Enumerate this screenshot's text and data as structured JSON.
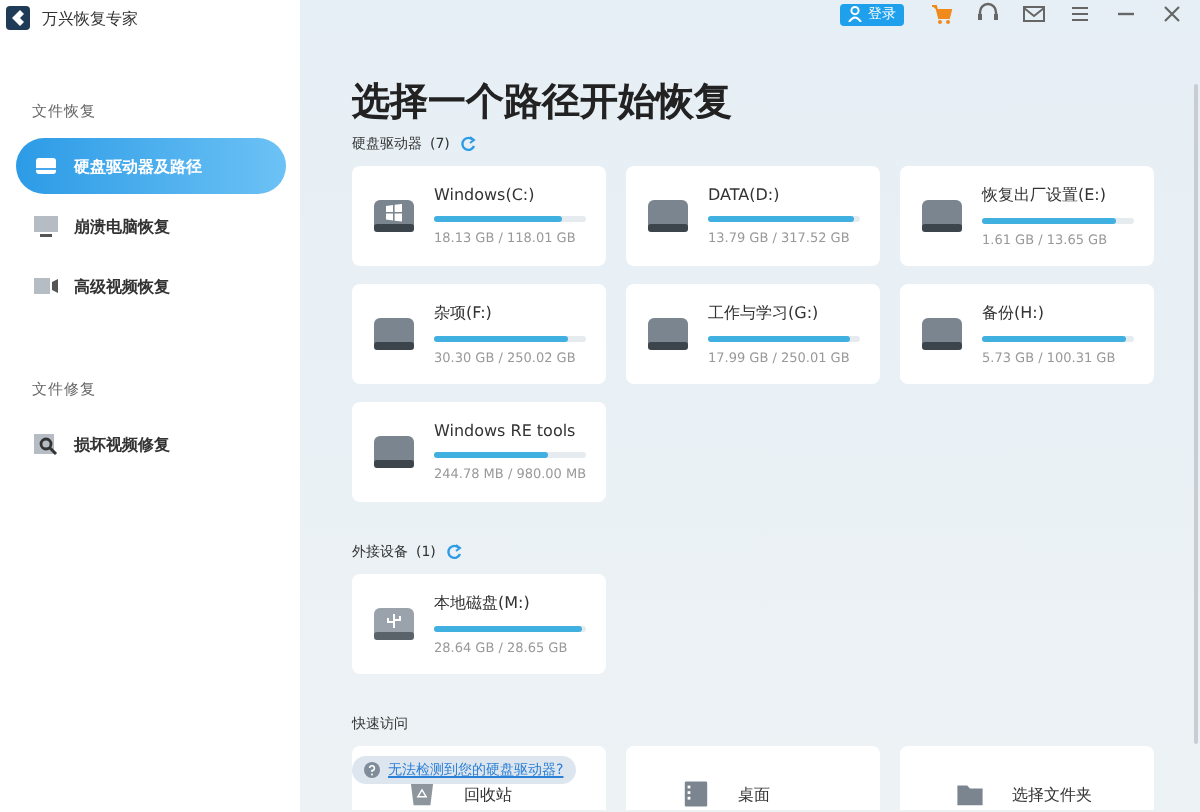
{
  "app": {
    "title": "万兴恢复专家"
  },
  "sidebar": {
    "sections": [
      {
        "label": "文件恢复",
        "items": [
          {
            "label": "硬盘驱动器及路径",
            "kind": "drive",
            "selected": true
          },
          {
            "label": "崩溃电脑恢复",
            "kind": "monitor",
            "selected": false
          },
          {
            "label": "高级视频恢复",
            "kind": "video",
            "selected": false
          }
        ]
      },
      {
        "label": "文件修复",
        "items": [
          {
            "label": "损坏视频修复",
            "kind": "repair",
            "selected": false
          }
        ]
      }
    ]
  },
  "toolbar": {
    "login": "登录"
  },
  "heading": "选择一个路径开始恢复",
  "drive_groups": [
    {
      "label": "硬盘驱动器",
      "count": "(7)",
      "drives": [
        {
          "name": "Windows(C:)",
          "kind": "system",
          "level": 0.84,
          "usage": "18.13 GB / 118.01 GB"
        },
        {
          "name": "DATA(D:)",
          "kind": "disk",
          "level": 0.96,
          "usage": "13.79 GB / 317.52 GB"
        },
        {
          "name": "恢复出厂设置(E:)",
          "kind": "disk",
          "level": 0.88,
          "usage": "1.61 GB / 13.65 GB"
        },
        {
          "name": "杂项(F:)",
          "kind": "disk",
          "level": 0.88,
          "usage": "30.30 GB / 250.02 GB"
        },
        {
          "name": "工作与学习(G:)",
          "kind": "disk",
          "level": 0.93,
          "usage": "17.99 GB / 250.01 GB"
        },
        {
          "name": "备份(H:)",
          "kind": "disk",
          "level": 0.95,
          "usage": "5.73 GB / 100.31 GB"
        },
        {
          "name": "Windows RE tools",
          "kind": "disk",
          "level": 0.75,
          "usage": "244.78 MB / 980.00 MB"
        }
      ]
    },
    {
      "label": "外接设备",
      "count": "(1)",
      "drives": [
        {
          "name": "本地磁盘(M:)",
          "kind": "usb",
          "level": 0.98,
          "usage": "28.64 GB / 28.65 GB"
        }
      ]
    }
  ],
  "quick_access": {
    "label": "快速访问",
    "items": [
      {
        "label": "回收站",
        "kind": "recycle"
      },
      {
        "label": "桌面",
        "kind": "desktop"
      },
      {
        "label": "选择文件夹",
        "kind": "folder"
      }
    ],
    "help_link": "无法检测到您的硬盘驱动器?"
  }
}
